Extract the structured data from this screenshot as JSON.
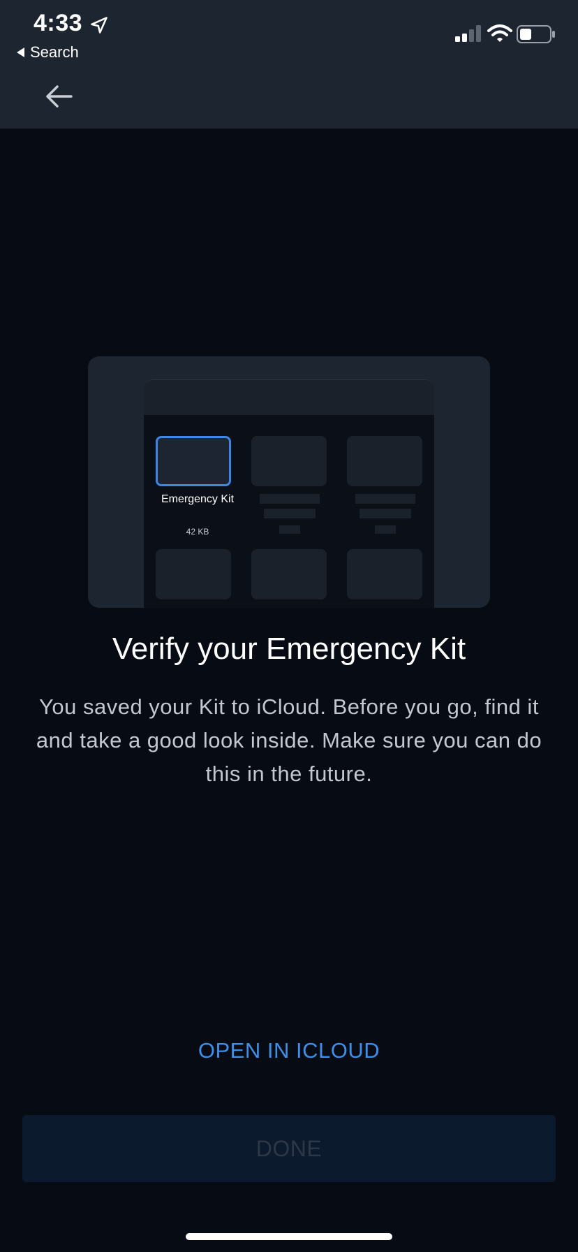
{
  "status_bar": {
    "time": "4:33",
    "back_app_label": "Search"
  },
  "illustration": {
    "file_name": "Emergency Kit",
    "file_size": "42 KB"
  },
  "content": {
    "title": "Verify your Emergency Kit",
    "description": "You saved your Kit to iCloud. Before you go, find it and take a good look inside. Make sure you can do this in the future."
  },
  "actions": {
    "open_icloud_label": "OPEN IN ICLOUD",
    "done_label": "DONE"
  },
  "colors": {
    "accent": "#3f8ee8",
    "background": "#070c14",
    "header": "#1d2530"
  },
  "icons": [
    "location-arrow-icon",
    "back-triangle-icon",
    "signal-icon",
    "wifi-icon",
    "battery-icon",
    "back-arrow-icon",
    "file-icon"
  ]
}
